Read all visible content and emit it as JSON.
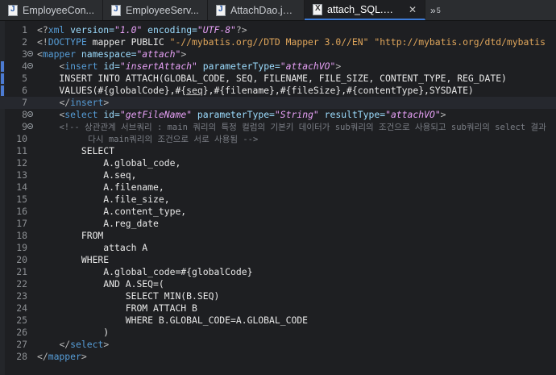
{
  "tabs": [
    {
      "label": "EmployeeCon...",
      "icon": "java-file-icon",
      "active": false
    },
    {
      "label": "EmployeeServ...",
      "icon": "java-file-icon",
      "active": false
    },
    {
      "label": "AttachDao.java",
      "icon": "java-file-icon",
      "active": false
    },
    {
      "label": "attach_SQL.xml",
      "icon": "xml-file-icon",
      "active": true,
      "close": "✕"
    }
  ],
  "tab_overflow": {
    "glyph": "»",
    "count": "5"
  },
  "editor": {
    "lines": [
      {
        "n": "1",
        "parts": [
          [
            "pr",
            "<?"
          ],
          [
            "kw",
            "xml "
          ],
          [
            "an",
            "version="
          ],
          [
            "av",
            "\"1.0\""
          ],
          [
            "an",
            " encoding="
          ],
          [
            "av",
            "\"UTF-8\""
          ],
          [
            "pr",
            "?>"
          ]
        ]
      },
      {
        "n": "2",
        "parts": [
          [
            "pr",
            "<!"
          ],
          [
            "kw",
            "DOCTYPE "
          ],
          [
            "sql",
            "mapper PUBLIC "
          ],
          [
            "dt",
            "\"-//mybatis.org//DTD Mapper 3.0//EN\" \"http://mybatis.org/dtd/mybatis"
          ]
        ]
      },
      {
        "n": "3",
        "fold": true,
        "parts": [
          [
            "pr",
            "<"
          ],
          [
            "kw",
            "mapper "
          ],
          [
            "an",
            "namespace="
          ],
          [
            "av",
            "\"attach\""
          ],
          [
            "pr",
            ">"
          ]
        ]
      },
      {
        "n": "4",
        "fold": true,
        "marker": true,
        "parts": [
          [
            "sql",
            "    "
          ],
          [
            "pr",
            "<"
          ],
          [
            "kw",
            "insert "
          ],
          [
            "an",
            "id="
          ],
          [
            "av",
            "\"insertAttach\""
          ],
          [
            "an",
            " parameterType="
          ],
          [
            "av",
            "\"attachVO\""
          ],
          [
            "pr",
            ">"
          ]
        ]
      },
      {
        "n": "5",
        "marker": true,
        "parts": [
          [
            "sql",
            "    INSERT INTO ATTACH(GLOBAL_CODE, SEQ, FILENAME, FILE_SIZE, CONTENT_TYPE, REG_DATE)"
          ]
        ]
      },
      {
        "n": "6",
        "marker": true,
        "parts": [
          [
            "sql",
            "    VALUES(#{globalCode},#{"
          ],
          [
            "ul",
            "seq"
          ],
          [
            "sql",
            "},#{filename},#{fileSize},#{contentType},SYSDATE)"
          ]
        ]
      },
      {
        "n": "7",
        "current": true,
        "parts": [
          [
            "sql",
            "    "
          ],
          [
            "pr",
            "</"
          ],
          [
            "kw",
            "insert"
          ],
          [
            "pr",
            ">"
          ]
        ]
      },
      {
        "n": "8",
        "fold": true,
        "parts": [
          [
            "sql",
            "    "
          ],
          [
            "pr",
            "<"
          ],
          [
            "kw",
            "select "
          ],
          [
            "an",
            "id="
          ],
          [
            "av",
            "\"getFileName\""
          ],
          [
            "an",
            " parameterType="
          ],
          [
            "av",
            "\"String\""
          ],
          [
            "an",
            " resultType="
          ],
          [
            "av",
            "\"attachVO\""
          ],
          [
            "pr",
            ">"
          ]
        ]
      },
      {
        "n": "9",
        "fold": true,
        "parts": [
          [
            "sql",
            "    "
          ],
          [
            "cm",
            "<!-- 상관관계 서브쿼리 : main 쿼리의 특정 컬럼의 기본키 데이터가 sub쿼리의 조건으로 사용되고 sub쿼리의 select 결과"
          ]
        ]
      },
      {
        "n": "10",
        "parts": [
          [
            "cm",
            "          다시 main쿼리의 조건으로 서로 사용됨 -->"
          ]
        ]
      },
      {
        "n": "11",
        "parts": [
          [
            "sql",
            "        SELECT"
          ]
        ]
      },
      {
        "n": "12",
        "parts": [
          [
            "sql",
            "            A.global_code,"
          ]
        ]
      },
      {
        "n": "13",
        "parts": [
          [
            "sql",
            "            A.seq,"
          ]
        ]
      },
      {
        "n": "14",
        "parts": [
          [
            "sql",
            "            A.filename,"
          ]
        ]
      },
      {
        "n": "15",
        "parts": [
          [
            "sql",
            "            A.file_size,"
          ]
        ]
      },
      {
        "n": "16",
        "parts": [
          [
            "sql",
            "            A.content_type,"
          ]
        ]
      },
      {
        "n": "17",
        "parts": [
          [
            "sql",
            "            A.reg_date"
          ]
        ]
      },
      {
        "n": "18",
        "parts": [
          [
            "sql",
            "        FROM"
          ]
        ]
      },
      {
        "n": "19",
        "parts": [
          [
            "sql",
            "            attach A"
          ]
        ]
      },
      {
        "n": "20",
        "parts": [
          [
            "sql",
            "        WHERE"
          ]
        ]
      },
      {
        "n": "21",
        "parts": [
          [
            "sql",
            "            A.global_code=#{globalCode}"
          ]
        ]
      },
      {
        "n": "22",
        "parts": [
          [
            "sql",
            "            AND A.SEQ=("
          ]
        ]
      },
      {
        "n": "23",
        "parts": [
          [
            "sql",
            "                SELECT MIN(B.SEQ)"
          ]
        ]
      },
      {
        "n": "24",
        "parts": [
          [
            "sql",
            "                FROM ATTACH B"
          ]
        ]
      },
      {
        "n": "25",
        "parts": [
          [
            "sql",
            "                WHERE B.GLOBAL_CODE=A.GLOBAL_CODE"
          ]
        ]
      },
      {
        "n": "26",
        "parts": [
          [
            "sql",
            "            )"
          ]
        ]
      },
      {
        "n": "27",
        "parts": [
          [
            "sql",
            "    "
          ],
          [
            "pr",
            "</"
          ],
          [
            "kw",
            "select"
          ],
          [
            "pr",
            ">"
          ]
        ]
      },
      {
        "n": "28",
        "parts": [
          [
            "pr",
            "</"
          ],
          [
            "kw",
            "mapper"
          ],
          [
            "pr",
            ">"
          ]
        ]
      }
    ]
  }
}
